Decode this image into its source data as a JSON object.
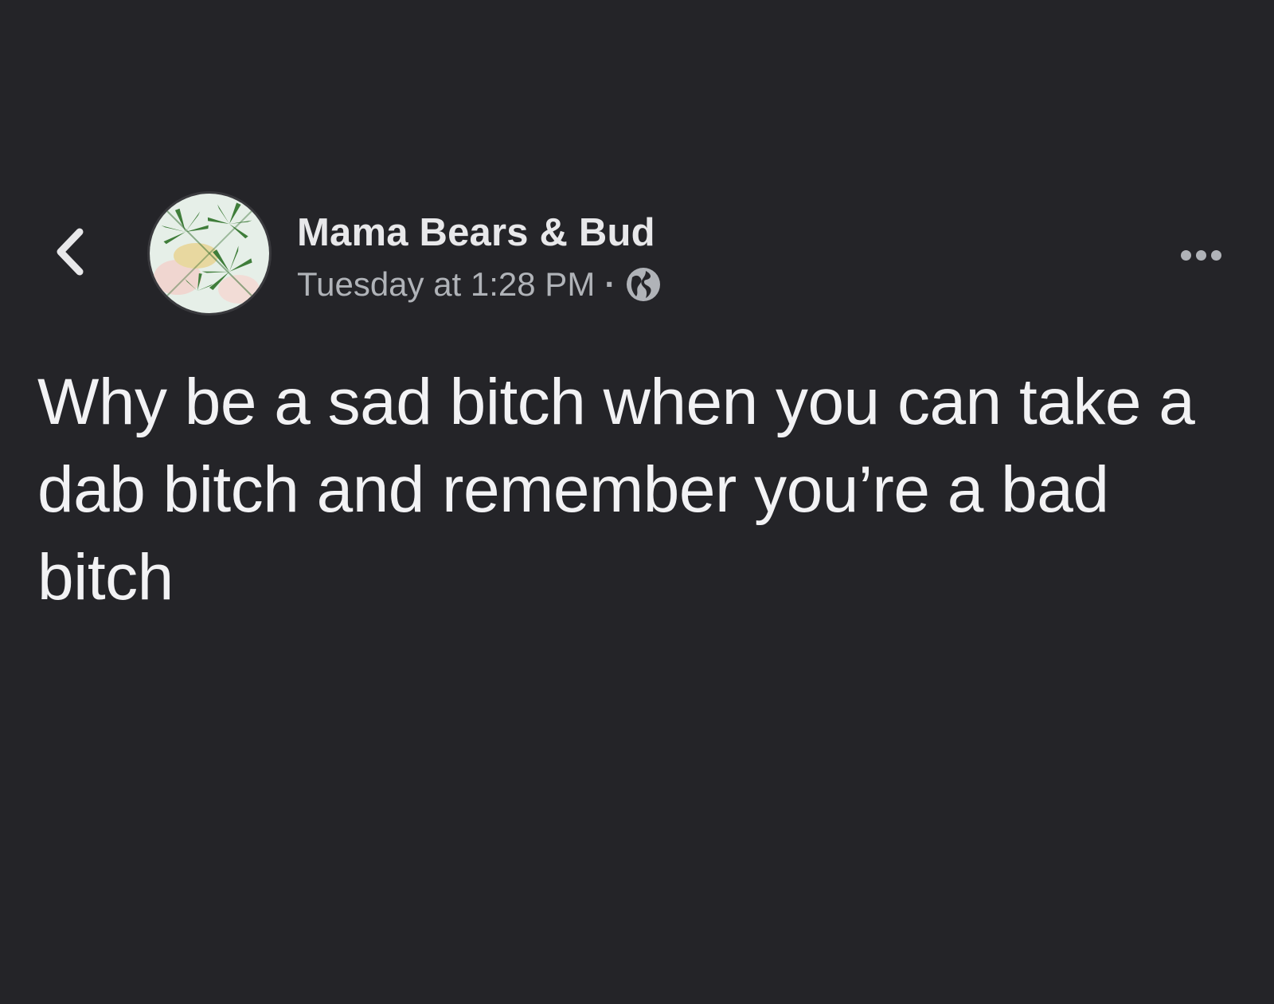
{
  "post": {
    "author": "Mama Bears & Bud",
    "timestamp": "Tuesday at 1:28 PM",
    "separator": "·",
    "audience_icon": "globe-icon",
    "body": "Why be a sad bitch when you can take a dab bitch and remember you’re a bad bitch"
  },
  "icons": {
    "back": "chevron-left-icon",
    "more": "more-horizontal-icon",
    "avatar": "cannabis-leaf-avatar"
  },
  "colors": {
    "background": "#242428",
    "primary_text": "#e8e8ea",
    "secondary_text": "#b0b3b8"
  }
}
